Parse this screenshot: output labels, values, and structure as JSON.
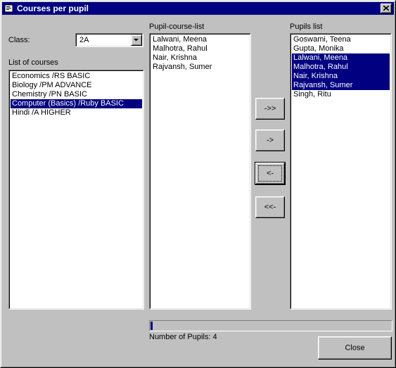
{
  "window": {
    "title": "Courses per pupil"
  },
  "class_selector": {
    "label": "Class:",
    "value": "2A"
  },
  "courses": {
    "label": "List of courses",
    "items": [
      "Economics  /RS BASIC",
      "Biology  /PM ADVANCE",
      "Chemistry  /PN BASIC",
      "Computer (Basics)  /Ruby BASIC",
      "Hindi  /A HIGHER"
    ],
    "selected_index": 3
  },
  "pupil_course_list": {
    "label": "Pupil-course-list",
    "items": [
      "Lalwani, Meena",
      "Malhotra, Rahul",
      "Nair, Krishna",
      "Rajvansh, Sumer"
    ]
  },
  "pupils_list": {
    "label": "Pupils list",
    "items": [
      "Goswami, Teena",
      "Gupta, Monika",
      "Lalwani, Meena",
      "Malhotra, Rahul",
      "Nair, Krishna",
      "Rajvansh, Sumer",
      "Singh, Ritu"
    ],
    "selected_indices": [
      2,
      3,
      4,
      5
    ]
  },
  "transfer_buttons": {
    "add_all": "->>",
    "add_one": "->",
    "remove_one": "<-",
    "remove_all": "<<-"
  },
  "progress": {
    "fraction": 0.01
  },
  "status": {
    "pupil_count_text": "Number of Pupils: 4"
  },
  "actions": {
    "close_label": "Close"
  }
}
